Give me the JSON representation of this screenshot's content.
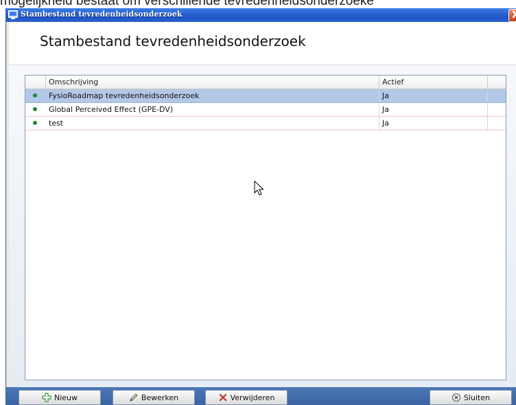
{
  "background_text": "mogelijkheid bestaat om verschillende tevredenheidsonderzoeke",
  "window": {
    "title": "Stambestand tevredenheidsonderzoek",
    "close_glyph": "X"
  },
  "header": {
    "title": "Stambestand tevredenheidsonderzoek"
  },
  "table": {
    "columns": [
      "Omschrijving",
      "Actief"
    ],
    "rows": [
      {
        "omschrijving": "FysioRoadmap tevredenheidsonderzoek",
        "actief": "Ja",
        "selected": true
      },
      {
        "omschrijving": "Global Perceived Effect (GPE-DV)",
        "actief": "Ja",
        "selected": false
      },
      {
        "omschrijving": "test",
        "actief": "Ja",
        "selected": false
      }
    ]
  },
  "footer": {
    "new_label": "Nieuw",
    "edit_label": "Bewerken",
    "delete_label": "Verwijderen",
    "close_label": "Sluiten"
  },
  "colors": {
    "status_active": "#1f8a3a",
    "selection": "#b3c8e6",
    "titlebar": "#2a63d0"
  },
  "icons": {
    "row_status": "green-dot-icon",
    "new": "green-plus-icon",
    "edit": "pencil-icon",
    "delete": "red-x-icon",
    "close": "circle-x-icon"
  }
}
